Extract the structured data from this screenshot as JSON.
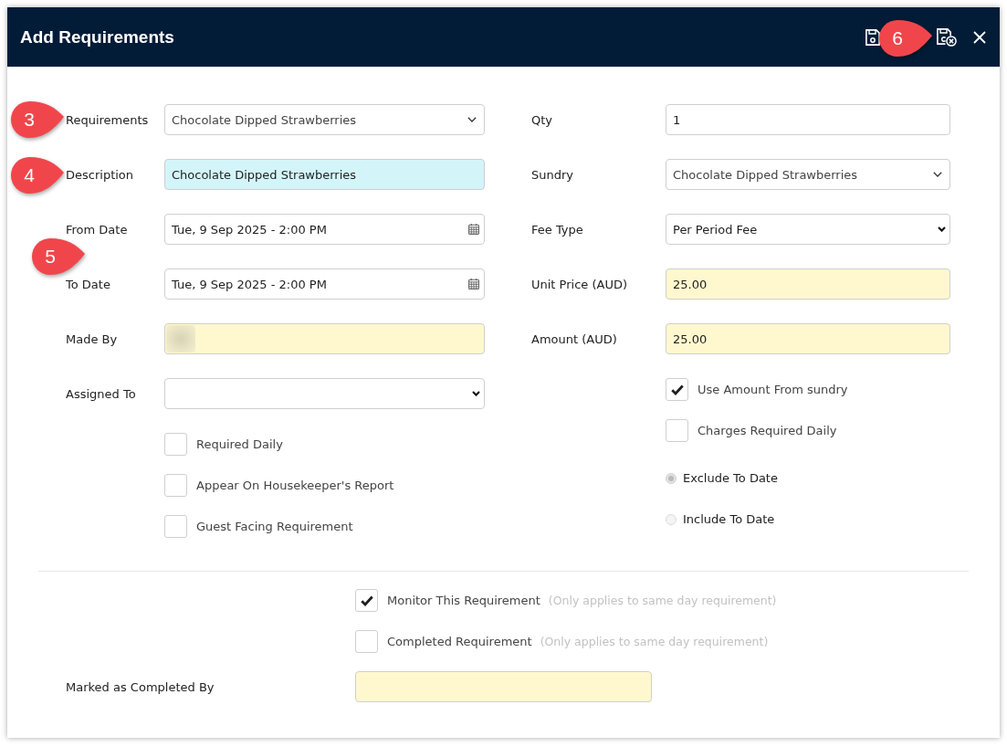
{
  "window": {
    "title": "Add Requirements"
  },
  "left_fields": [
    {
      "label": "Requirements",
      "kind": "combo",
      "value": "Chocolate Dipped Strawberries",
      "readonly": false,
      "focused": false
    },
    {
      "label": "Description",
      "kind": "text",
      "value": "Chocolate Dipped Strawberries",
      "readonly": false,
      "focused": true
    },
    {
      "label": "From Date",
      "kind": "date",
      "value": "Tue, 9 Sep 2025 - 2:00 PM",
      "readonly": false,
      "focused": false
    },
    {
      "label": "To Date",
      "kind": "date",
      "value": "Tue, 9 Sep 2025 - 2:00 PM",
      "readonly": false,
      "focused": false
    },
    {
      "label": "Made By",
      "kind": "redacted",
      "readonly": true,
      "focused": false
    },
    {
      "label": "Assigned To",
      "kind": "select",
      "readonly": false,
      "focused": false
    }
  ],
  "left_checks": [
    {
      "label": "Required Daily",
      "checked": false
    },
    {
      "label": "Appear On Housekeeper's Report",
      "checked": false
    },
    {
      "label": "Guest Facing Requirement",
      "checked": false
    }
  ],
  "right_fields": [
    {
      "label": "Qty",
      "kind": "text",
      "value": "1",
      "readonly": false,
      "focused": false
    },
    {
      "label": "Sundry",
      "kind": "combo",
      "value": "Chocolate Dipped Strawberries",
      "readonly": false,
      "focused": false
    },
    {
      "label": "Fee Type",
      "kind": "select",
      "value": "Per Period Fee",
      "readonly": false,
      "focused": false
    },
    {
      "label": "Unit Price (AUD)",
      "kind": "text",
      "value": "25.00",
      "readonly": true,
      "focused": false
    },
    {
      "label": "Amount (AUD)",
      "kind": "text",
      "value": "25.00",
      "readonly": true,
      "focused": false
    }
  ],
  "right_checks": [
    {
      "label": "Use Amount From sundry",
      "checked": true
    },
    {
      "label": "Charges Required Daily",
      "checked": false
    }
  ],
  "date_options": [
    {
      "label": "Exclude To Date",
      "selected": true,
      "disabled": true
    },
    {
      "label": "Include To Date",
      "selected": false,
      "disabled": true
    }
  ],
  "monitor_checks": [
    {
      "label": "Monitor This Requirement",
      "hint": "(Only applies to same day requirement)",
      "checked": true
    },
    {
      "label": "Completed Requirement",
      "hint": "(Only applies to same day requirement)",
      "checked": false
    }
  ],
  "completed_by": {
    "label": "Marked as Completed By",
    "kind": "text",
    "readonly": true,
    "focused": false
  },
  "callouts": [
    {
      "label": "3"
    },
    {
      "label": "4"
    },
    {
      "label": "5"
    },
    {
      "label": "6"
    }
  ]
}
